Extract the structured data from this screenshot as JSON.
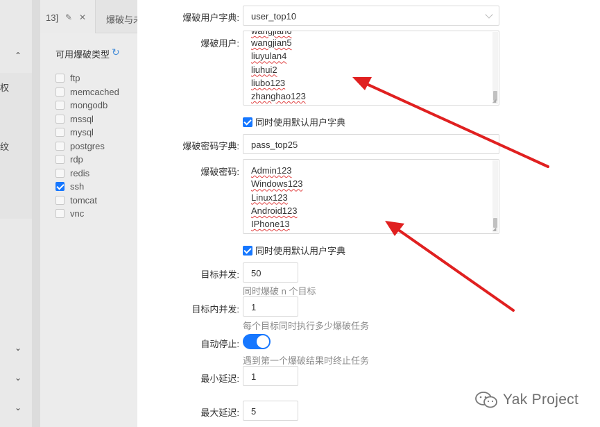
{
  "left_rail": {
    "texts": [
      "权",
      "纹"
    ]
  },
  "tabs": {
    "tab1_label": "13]",
    "tab2_label": "爆破与未"
  },
  "types": {
    "title": "可用爆破类型",
    "items": [
      {
        "label": "ftp",
        "checked": false
      },
      {
        "label": "memcached",
        "checked": false
      },
      {
        "label": "mongodb",
        "checked": false
      },
      {
        "label": "mssql",
        "checked": false
      },
      {
        "label": "mysql",
        "checked": false
      },
      {
        "label": "postgres",
        "checked": false
      },
      {
        "label": "rdp",
        "checked": false
      },
      {
        "label": "redis",
        "checked": false
      },
      {
        "label": "ssh",
        "checked": true
      },
      {
        "label": "tomcat",
        "checked": false
      },
      {
        "label": "vnc",
        "checked": false
      }
    ]
  },
  "form": {
    "user_dict_label": "爆破用户字典:",
    "user_dict_value": "user_top10",
    "users_label": "爆破用户:",
    "users": [
      "wangjian5",
      "liuyulan4",
      "liuhui2",
      "liubo123",
      "zhanghao123"
    ],
    "use_default_user": "同时使用默认用户字典",
    "pass_dict_label": "爆破密码字典:",
    "pass_dict_value": "pass_top25",
    "pass_label": "爆破密码:",
    "passwords": [
      "Admin123",
      "Windows123",
      "Linux123",
      "Android123",
      "IPhone13"
    ],
    "use_default_pass": "同时使用默认用户字典",
    "target_concurrency_label": "目标并发:",
    "target_concurrency_value": "50",
    "target_concurrency_hint": "同时爆破 n 个目标",
    "inner_concurrency_label": "目标内并发:",
    "inner_concurrency_value": "1",
    "inner_concurrency_hint": "每个目标同时执行多少爆破任务",
    "auto_stop_label": "自动停止:",
    "auto_stop_on": true,
    "auto_stop_hint": "遇到第一个爆破结果时终止任务",
    "min_delay_label": "最小延迟:",
    "min_delay_value": "1",
    "max_delay_label": "最大延迟:",
    "max_delay_value": "5"
  },
  "watermark": {
    "text": "Yak Project"
  },
  "colors": {
    "accent": "#1677ff",
    "arrow": "#e02020"
  }
}
